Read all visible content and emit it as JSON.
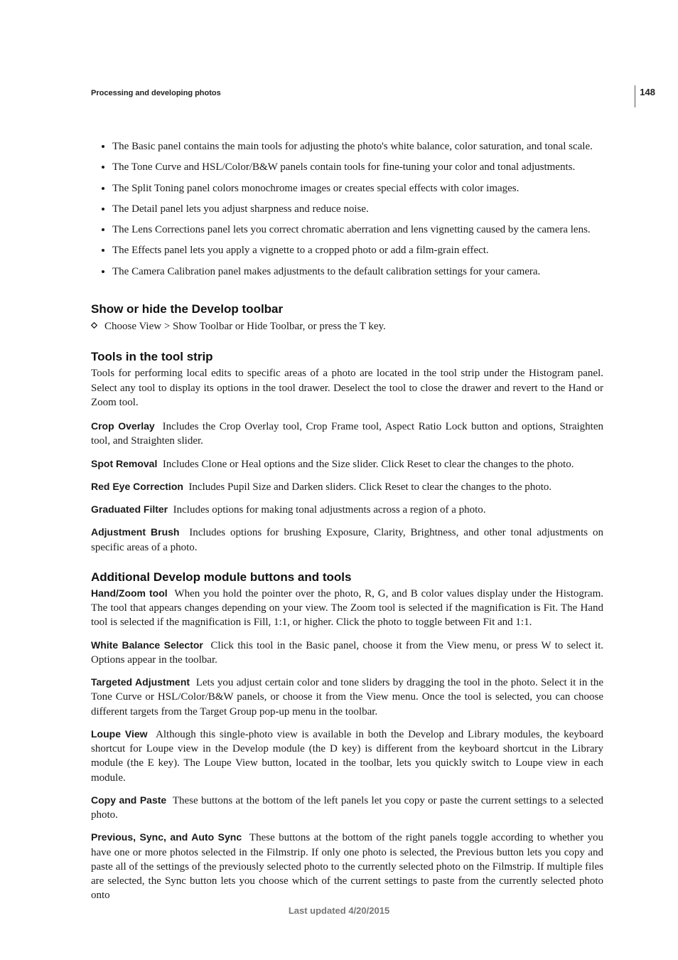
{
  "page_number": "148",
  "running_header": "Processing and developing photos",
  "bullets": [
    "The Basic panel contains the main tools for adjusting the photo's white balance, color saturation, and tonal scale.",
    "The Tone Curve and HSL/Color/B&W panels contain tools for fine-tuning your color and tonal adjustments.",
    "The Split Toning panel colors monochrome images or creates special effects with color images.",
    "The Detail panel lets you adjust sharpness and reduce noise.",
    "The Lens Corrections panel lets you correct chromatic aberration and lens vignetting caused by the camera lens.",
    "The Effects panel lets you apply a vignette to a cropped photo or add a film-grain effect.",
    "The Camera Calibration panel makes adjustments to the default calibration settings for your camera."
  ],
  "section1": {
    "heading": "Show or hide the Develop toolbar",
    "step": "Choose View > Show Toolbar or Hide Toolbar, or press the T key."
  },
  "section2": {
    "heading": "Tools in the tool strip",
    "intro": "Tools for performing local edits to specific areas of a photo are located in the tool strip under the Histogram panel. Select any tool to display its options in the tool drawer. Deselect the tool to close the drawer and revert to the Hand or Zoom tool.",
    "items": [
      {
        "term": "Crop Overlay",
        "desc": "Includes the Crop Overlay tool, Crop Frame tool, Aspect Ratio Lock button and options, Straighten tool, and Straighten slider."
      },
      {
        "term": "Spot Removal",
        "desc": "Includes Clone or Heal options and the Size slider. Click Reset to clear the changes to the photo."
      },
      {
        "term": "Red Eye Correction",
        "desc": "Includes Pupil Size and Darken sliders. Click Reset to clear the changes to the photo."
      },
      {
        "term": "Graduated Filter",
        "desc": "Includes options for making tonal adjustments across a region of a photo."
      },
      {
        "term": "Adjustment Brush",
        "desc": "Includes options for brushing Exposure, Clarity, Brightness, and other tonal adjustments on specific areas of a photo."
      }
    ]
  },
  "section3": {
    "heading": "Additional Develop module buttons and tools",
    "items": [
      {
        "term": "Hand/Zoom tool",
        "desc": "When you hold the pointer over the photo, R, G, and B color values display under the Histogram. The tool that appears changes depending on your view. The Zoom tool is selected if the magnification is Fit. The Hand tool is selected if the magnification is Fill, 1:1, or higher. Click the photo to toggle between Fit and 1:1."
      },
      {
        "term": "White Balance Selector",
        "desc": "Click this tool in the Basic panel, choose it from the View menu, or press W to select it. Options appear in the toolbar."
      },
      {
        "term": "Targeted Adjustment",
        "desc": "Lets you adjust certain color and tone sliders by dragging the tool in the photo. Select it in the Tone Curve or HSL/Color/B&W panels, or choose it from the View menu. Once the tool is selected, you can choose different targets from the Target Group pop-up menu in the toolbar."
      },
      {
        "term": "Loupe View",
        "desc": "Although this single-photo view is available in both the Develop and Library modules, the keyboard shortcut for Loupe view in the Develop module (the D key) is different from the keyboard shortcut in the Library module (the E key). The Loupe View button, located in the toolbar, lets you quickly switch to Loupe view in each module."
      },
      {
        "term": "Copy and Paste",
        "desc": "These buttons at the bottom of the left panels let you copy or paste the current settings to a selected photo."
      },
      {
        "term": "Previous, Sync, and Auto Sync",
        "desc": "These buttons at the bottom of the right panels toggle according to whether you have one or more photos selected in the Filmstrip. If only one photo is selected, the Previous button lets you copy and paste all of the settings of the previously selected photo to the currently selected photo on the Filmstrip. If multiple files are selected, the Sync button lets you choose which of the current settings to paste from the currently selected photo onto"
      }
    ]
  },
  "footer": "Last updated 4/20/2015"
}
